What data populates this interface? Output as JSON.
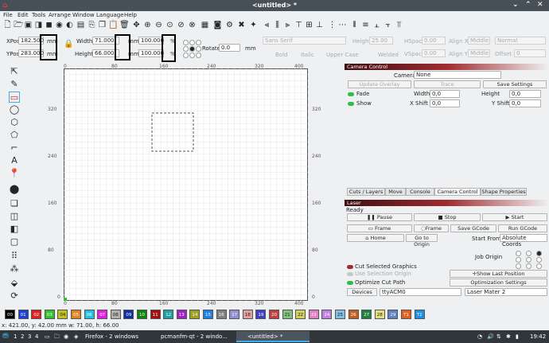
{
  "window": {
    "title": "<untitled> *"
  },
  "menu": [
    "File",
    "Edit",
    "Tools",
    "Arrange",
    "Window",
    "Language",
    "Help"
  ],
  "toolbar_icons": [
    "new-file-icon",
    "open-folder-icon",
    "save-icon",
    "save-as-icon",
    "record-icon",
    "circle-icon",
    "image-icon",
    "copy-icon",
    "paste-icon",
    "trash-icon",
    "move-icon",
    "zoom-in-icon",
    "zoom-out-icon",
    "zoom-fit-icon",
    "zoom-icon",
    "zoom-page-icon",
    "zoom-reset-icon",
    "settings-icon",
    "tools-icon",
    "plugin-icon",
    "align-left-icon",
    "align-center-icon",
    "align-right-icon",
    "align-top-icon",
    "align-middle-icon",
    "align-bottom-icon",
    "distribute-h-icon",
    "distribute-v-icon"
  ],
  "props": {
    "xpos_label": "XPos",
    "xpos_value": "182.500",
    "xpos_unit": "mm",
    "ypos_label": "YPos",
    "ypos_value": "283.000",
    "ypos_unit": "mm",
    "width_label": "Width",
    "width_value": "71.000",
    "width_unit": "mm",
    "width_pct": "100.000",
    "width_pct_unit": "%",
    "height_label": "Height",
    "height_value": "66.000",
    "height_unit": "mm",
    "height_pct": "100.000",
    "height_pct_unit": "%",
    "rotate_label": "Rotate",
    "rotate_value": "0.0",
    "rotate_unit": "mm"
  },
  "font_props": {
    "font_value": "Sans Serif",
    "height_label": "Height",
    "height_value": "25.00",
    "hspace_label": "HSpace",
    "hspace_value": "0.00",
    "align_x_label": "Align X",
    "align_x_value": "Middle",
    "style_value": "Normal",
    "bold_label": "Bold",
    "italic_label": "Italic",
    "upper_label": "Upper Case",
    "welded_label": "Welded",
    "vspace_label": "VSpace",
    "vspace_value": "0.00",
    "align_y_label": "Align Y",
    "align_y_value": "Middle",
    "offset_label": "Offset",
    "offset_value": "0"
  },
  "rulers": {
    "top": [
      "0",
      "80",
      "160",
      "240",
      "320",
      "400"
    ],
    "bottom": [
      "0",
      "80",
      "160",
      "240",
      "320",
      "400"
    ],
    "left": [
      "320",
      "240",
      "160",
      "80",
      "0"
    ],
    "right": [
      "320",
      "240",
      "160",
      "80",
      "0"
    ]
  },
  "camera": {
    "header": "Camera Control",
    "camera_label": "Camera:",
    "camera_value": "None",
    "update_overlay": "Update Overlay",
    "trace": "Trace",
    "save_settings": "Save Settings",
    "fade_label": "Fade",
    "width_label": "Width",
    "width_value": "0,0",
    "height_label": "Height",
    "height_value": "0,0",
    "show_label": "Show",
    "xshift_label": "X Shift",
    "xshift_value": "0,0",
    "yshift_label": "Y Shift",
    "yshift_value": "0,0"
  },
  "tabs": [
    "Cuts / Layers",
    "Move",
    "Console",
    "Camera Control",
    "Shape Properties"
  ],
  "laser": {
    "header": "Laser",
    "status": "Ready",
    "pause": "Pause",
    "stop": "Stop",
    "start": "Start",
    "frame1": "Frame",
    "frame2": "Frame",
    "save_gcode": "Save GCode",
    "run_gcode": "Run GCode",
    "home": "Home",
    "goto_origin": "Go to Origin",
    "start_from_label": "Start From:",
    "start_from_value": "Absolute Coords",
    "job_origin_label": "Job Origin",
    "cut_selected": "Cut Selected Graphics",
    "use_selection_origin": "Use Selection Origin",
    "optimize_cut": "Optimize Cut Path",
    "show_last_position": "Show Last Position",
    "optimization_settings": "Optimization Settings",
    "devices": "Devices",
    "port_value": "ttyACM0",
    "machine_value": "Laser Mater 2"
  },
  "palette": [
    {
      "label": "00",
      "color": "#000000"
    },
    {
      "label": "01",
      "color": "#1f3fd0"
    },
    {
      "label": "02",
      "color": "#e02020"
    },
    {
      "label": "03",
      "color": "#30c030"
    },
    {
      "label": "04",
      "color": "#c0c020"
    },
    {
      "label": "05",
      "color": "#e08020"
    },
    {
      "label": "06",
      "color": "#20c0e0"
    },
    {
      "label": "07",
      "color": "#e020e0"
    },
    {
      "label": "08",
      "color": "#b0b0b0"
    },
    {
      "label": "09",
      "color": "#1030a0"
    },
    {
      "label": "10",
      "color": "#108010"
    },
    {
      "label": "11",
      "color": "#a01010"
    },
    {
      "label": "12",
      "color": "#20a0a0"
    },
    {
      "label": "13",
      "color": "#a020c0"
    },
    {
      "label": "14",
      "color": "#a0a020"
    },
    {
      "label": "15",
      "color": "#2080e0"
    },
    {
      "label": "16",
      "color": "#808080"
    },
    {
      "label": "17",
      "color": "#9090d0"
    },
    {
      "label": "18",
      "color": "#e0a0a0"
    },
    {
      "label": "19",
      "color": "#4040c0"
    },
    {
      "label": "20",
      "color": "#c04040"
    },
    {
      "label": "21",
      "color": "#80c080"
    },
    {
      "label": "22",
      "color": "#d0d060"
    },
    {
      "label": "23",
      "color": "#e080c0"
    },
    {
      "label": "24",
      "color": "#c080e0"
    },
    {
      "label": "25",
      "color": "#80c0e0"
    },
    {
      "label": "26",
      "color": "#c06020"
    },
    {
      "label": "27",
      "color": "#208040"
    },
    {
      "label": "28",
      "color": "#e0e080"
    },
    {
      "label": "29",
      "color": "#6080c0"
    },
    {
      "label": "T1",
      "color": "#e06020"
    },
    {
      "label": "T2",
      "color": "#2090e0"
    }
  ],
  "status": "x: 421.00, y: 42.00 mm  w: 71.00,  h: 66.00",
  "taskbar": {
    "desktops": [
      "1",
      "2",
      "3",
      "4"
    ],
    "firefox": "Firefox - 2 windows",
    "pcmanfm": "pcmanfm-qt - 2 windo...",
    "lightburn": "<untitled> *",
    "clock": "19:42"
  },
  "colors": {
    "accent": "#3daee9",
    "toggle_on": "#2bbf4a",
    "laser_header": "#a02c30"
  }
}
